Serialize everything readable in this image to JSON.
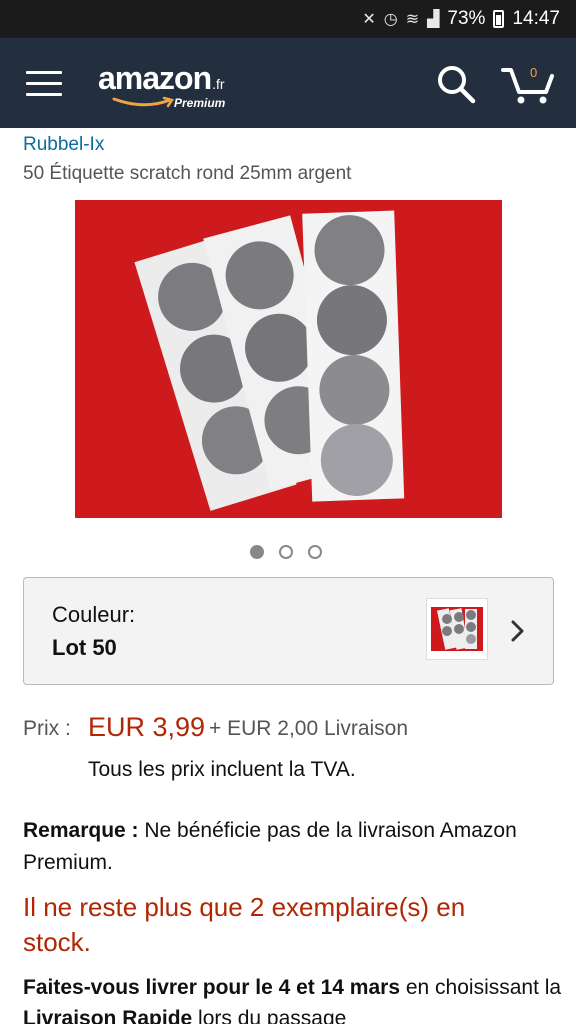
{
  "status_bar": {
    "battery": "73%",
    "time": "14:47"
  },
  "header": {
    "logo_text": "amazon",
    "logo_tld": ".fr",
    "logo_sub": "Premium",
    "cart_count": "0"
  },
  "product": {
    "brand": "Rubbel-Ix",
    "title": "50 Étiquette scratch rond 25mm argent",
    "image_count": 3,
    "active_image": 1
  },
  "variant": {
    "label": "Couleur:",
    "value": "Lot 50"
  },
  "price": {
    "label": "Prix :",
    "value": "EUR 3,99",
    "shipping": "+ EUR 2,00 Livraison",
    "vat_note": "Tous les prix incluent la TVA."
  },
  "remark": {
    "label": "Remarque :",
    "text": " Ne bénéficie pas de la livraison Amazon Premium."
  },
  "stock": {
    "text": "Il ne reste plus que 2 exemplaire(s) en stock."
  },
  "delivery": {
    "prefix": "Faites-vous livrer pour le ",
    "dates": "4 et 14 mars",
    "middle": " en choisissant la ",
    "method": "Livraison Rapide",
    "suffix": " lors du passage"
  },
  "colors": {
    "header_bg": "#232f3e",
    "link": "#0a6c9f",
    "price": "#b12704",
    "image_bg": "#cf1a1d"
  }
}
